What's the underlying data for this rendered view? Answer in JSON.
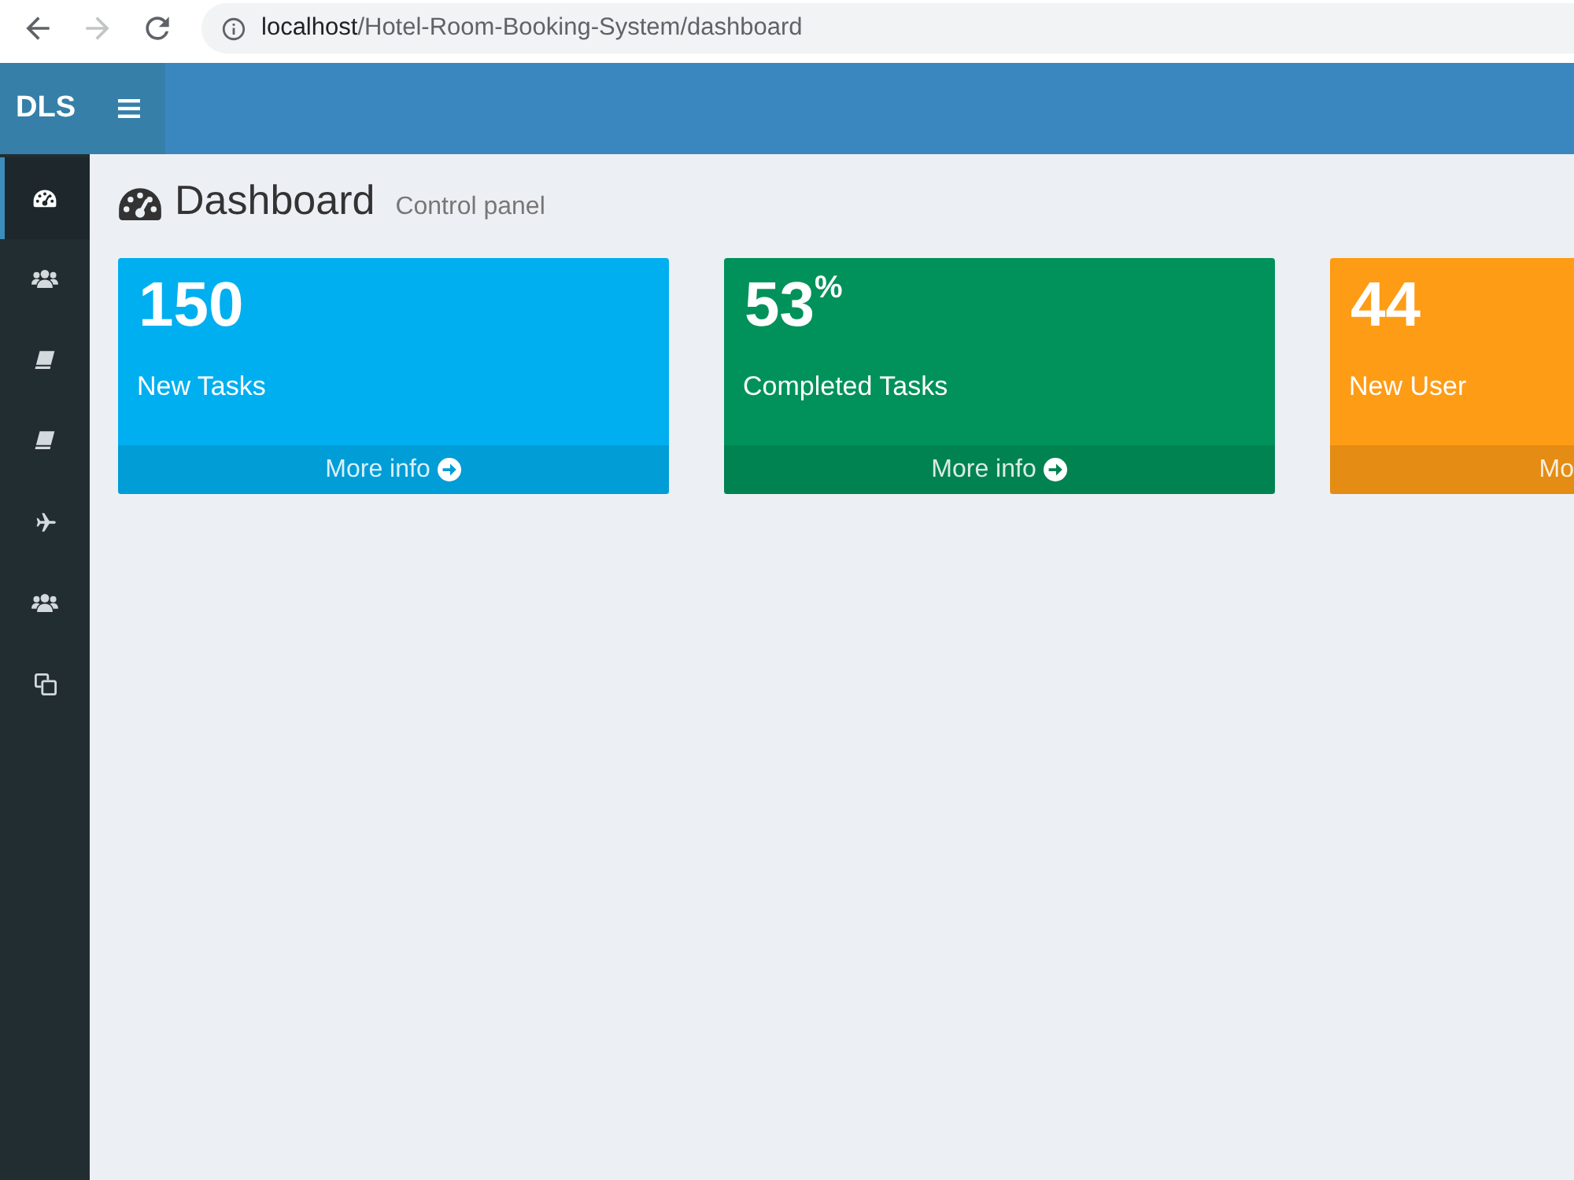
{
  "browser": {
    "back": {
      "disabled": false
    },
    "forward": {
      "disabled": true
    },
    "url_host": "localhost",
    "url_path": "/Hotel-Room-Booking-System/dashboard"
  },
  "header": {
    "brand": "DLS"
  },
  "sidebar": {
    "items": [
      {
        "kind": "dashboard",
        "selected": true
      },
      {
        "kind": "users",
        "selected": false
      },
      {
        "kind": "book",
        "selected": false
      },
      {
        "kind": "book",
        "selected": false
      },
      {
        "kind": "plane",
        "selected": false
      },
      {
        "kind": "users",
        "selected": false
      },
      {
        "kind": "copy",
        "selected": false
      }
    ]
  },
  "page": {
    "title": "Dashboard",
    "subtitle": "Control panel"
  },
  "cards": [
    {
      "value": "150",
      "label": "New Tasks",
      "link": "More info",
      "arrow_icon": true,
      "color": "#00aff0"
    },
    {
      "value": "53$^{%}$",
      "label": "Completed Tasks",
      "link": "More info",
      "arrow_icon": true,
      "color": "#00925a"
    },
    {
      "value": "44",
      "label": "New User",
      "link": "Mo",
      "arrow_icon": false,
      "color": "#fe9c16"
    }
  ]
}
